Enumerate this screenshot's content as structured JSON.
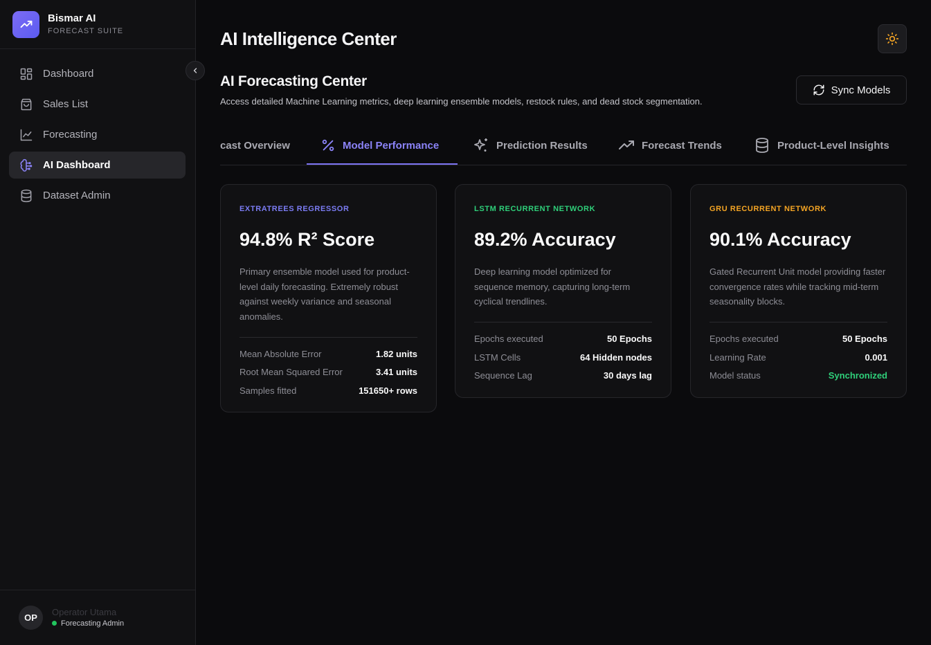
{
  "brand": {
    "name": "Bismar AI",
    "subtitle": "FORECAST SUITE"
  },
  "sidebar": {
    "items": [
      {
        "label": "Dashboard",
        "icon": "grid-icon",
        "active": false
      },
      {
        "label": "Sales List",
        "icon": "shopping-bag-icon",
        "active": false
      },
      {
        "label": "Forecasting",
        "icon": "line-chart-icon",
        "active": false
      },
      {
        "label": "AI Dashboard",
        "icon": "brain-circuit-icon",
        "active": true
      },
      {
        "label": "Dataset Admin",
        "icon": "database-icon",
        "active": false
      }
    ]
  },
  "user": {
    "initials": "OP",
    "name": "Operator Utama",
    "role": "Forecasting Admin"
  },
  "header": {
    "title": "AI Intelligence Center"
  },
  "section": {
    "title": "AI Forecasting Center",
    "description": "Access detailed Machine Learning metrics, deep learning ensemble models, restock rules, and dead stock segmentation.",
    "sync_label": "Sync Models"
  },
  "tabs": [
    {
      "label": "cast Overview",
      "active": false
    },
    {
      "label": "Model Performance",
      "active": true
    },
    {
      "label": "Prediction Results",
      "active": false
    },
    {
      "label": "Forecast Trends",
      "active": false
    },
    {
      "label": "Product-Level Insights",
      "active": false
    }
  ],
  "cards": [
    {
      "tag": "EXTRATREES REGRESSOR",
      "tag_color": "#7b7cf3",
      "metric": "94.8% R² Score",
      "description": "Primary ensemble model used for product-level daily forecasting. Extremely robust against weekly variance and seasonal anomalies.",
      "stats": [
        {
          "label": "Mean Absolute Error",
          "value": "1.82 units"
        },
        {
          "label": "Root Mean Squared Error",
          "value": "3.41 units"
        },
        {
          "label": "Samples fitted",
          "value": "151650+ rows"
        }
      ]
    },
    {
      "tag": "LSTM RECURRENT NETWORK",
      "tag_color": "#2fd07a",
      "metric": "89.2% Accuracy",
      "description": "Deep learning model optimized for sequence memory, capturing long-term cyclical trendlines.",
      "stats": [
        {
          "label": "Epochs executed",
          "value": "50 Epochs"
        },
        {
          "label": "LSTM Cells",
          "value": "64 Hidden nodes"
        },
        {
          "label": "Sequence Lag",
          "value": "30 days lag"
        }
      ]
    },
    {
      "tag": "GRU RECURRENT NETWORK",
      "tag_color": "#f5a524",
      "metric": "90.1% Accuracy",
      "description": "Gated Recurrent Unit model providing faster convergence rates while tracking mid-term seasonality blocks.",
      "stats": [
        {
          "label": "Epochs executed",
          "value": "50 Epochs"
        },
        {
          "label": "Learning Rate",
          "value": "0.001"
        },
        {
          "label": "Model status",
          "value": "Synchronized"
        }
      ]
    }
  ]
}
